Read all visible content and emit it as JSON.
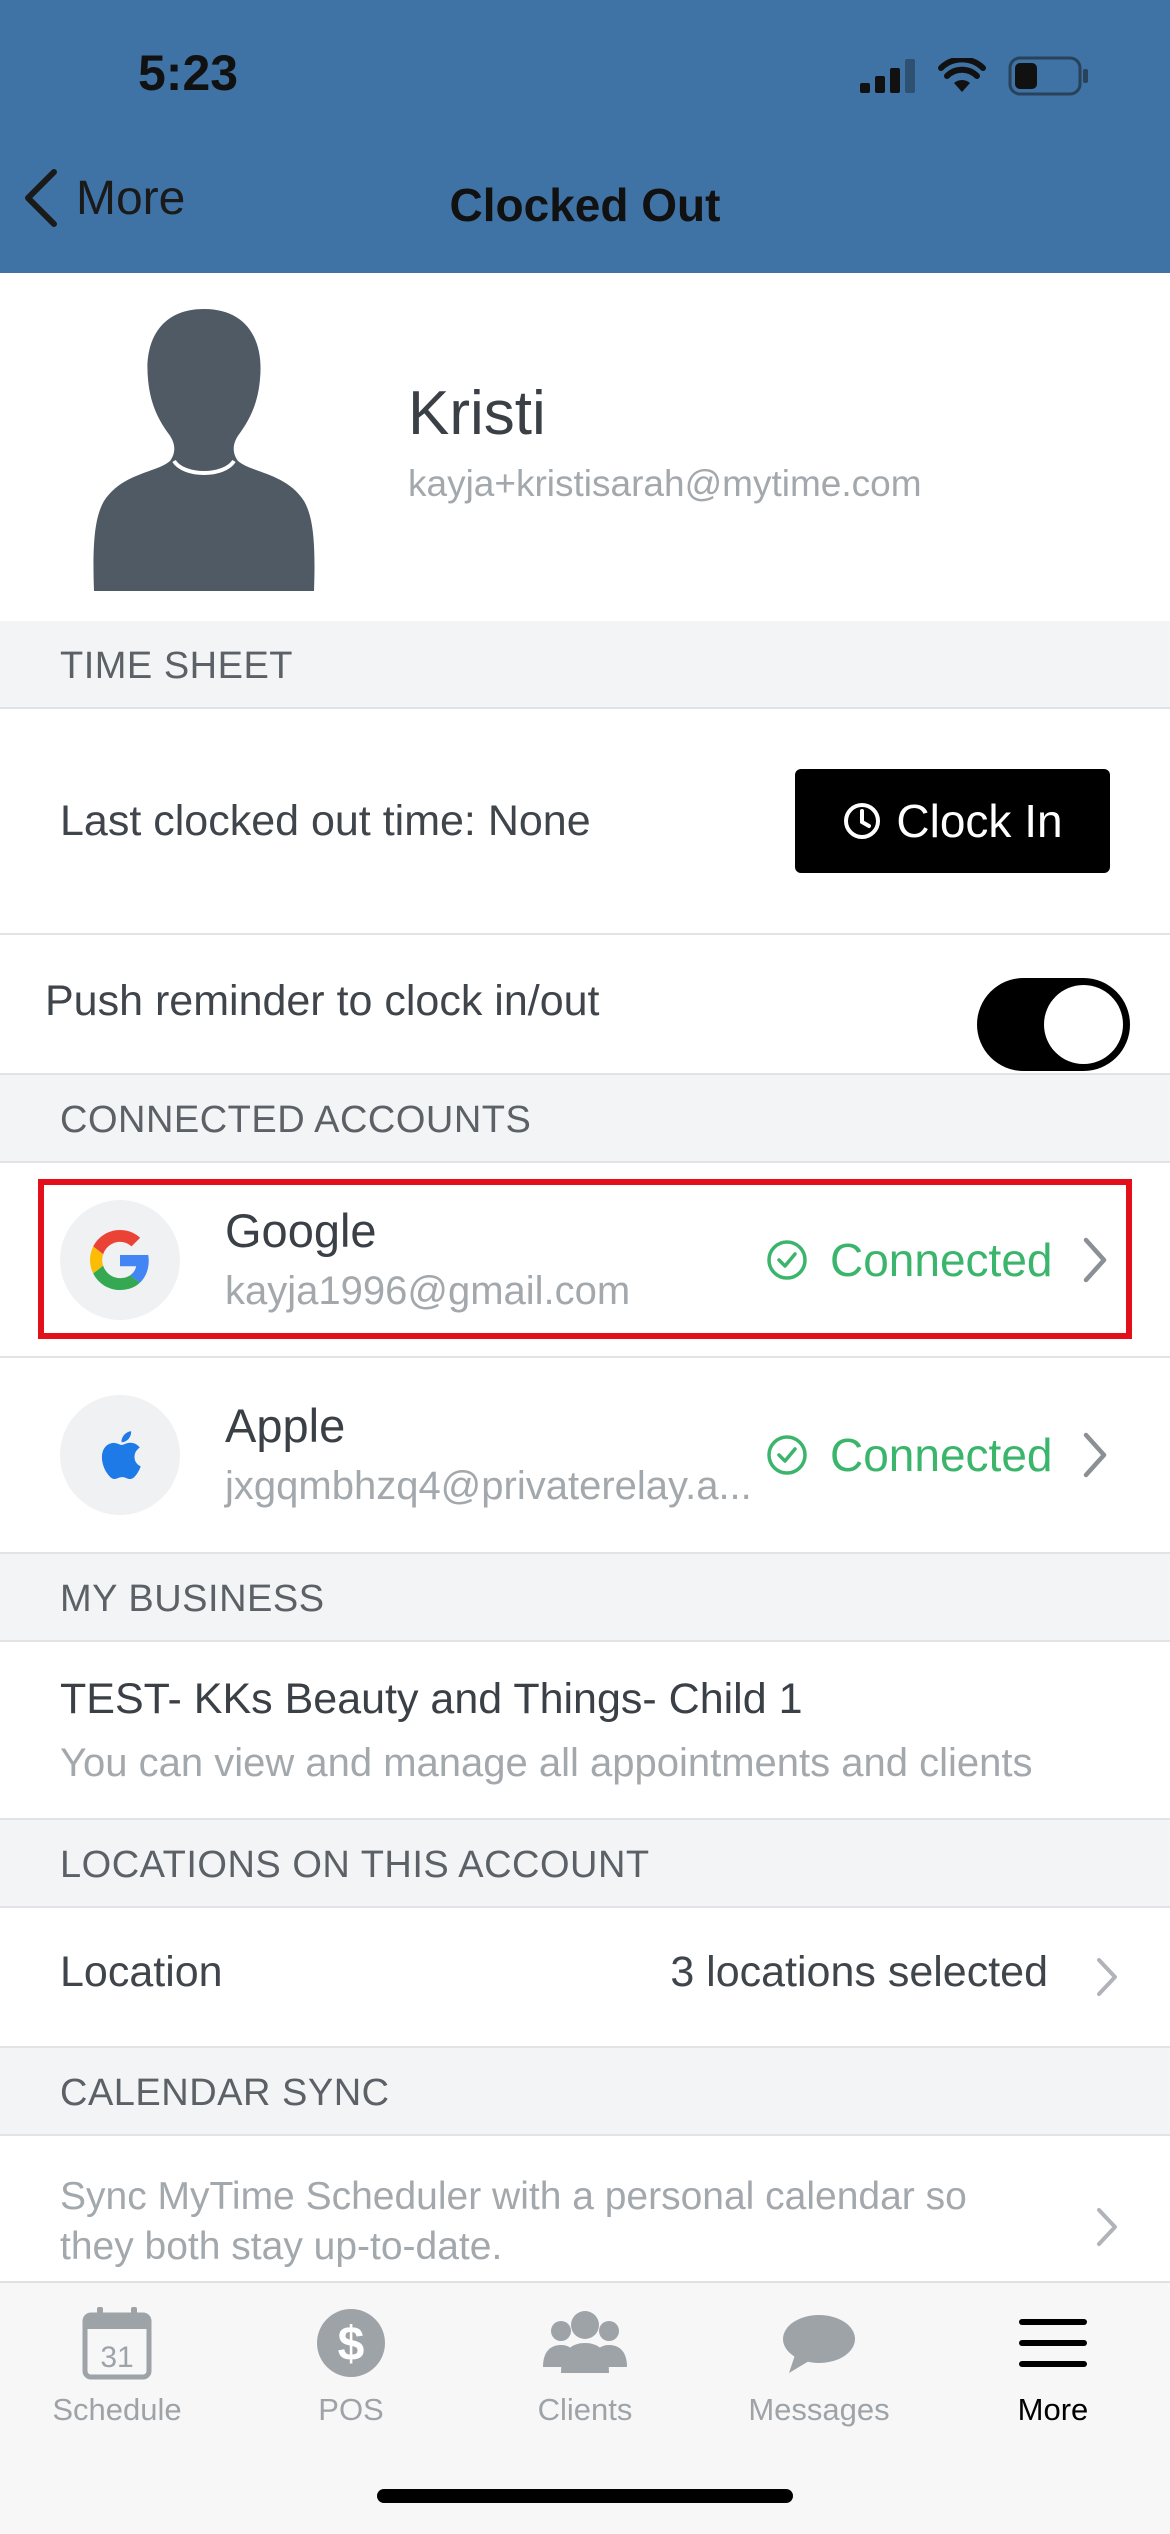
{
  "status_bar": {
    "time": "5:23"
  },
  "nav": {
    "back_label": "More",
    "title": "Clocked Out"
  },
  "profile": {
    "name": "Kristi",
    "email": "kayja+kristisarah@mytime.com"
  },
  "time_sheet": {
    "header": "TIME SHEET",
    "last_clocked_out": "Last clocked out time: None",
    "clock_in_label": "Clock In",
    "push_reminder_label": "Push reminder to clock in/out",
    "push_reminder_on": true
  },
  "connected_accounts": {
    "header": "CONNECTED ACCOUNTS",
    "items": [
      {
        "provider": "Google",
        "email": "kayja1996@gmail.com",
        "status": "Connected",
        "icon": "google-icon"
      },
      {
        "provider": "Apple",
        "email": "jxgqmbhzq4@privaterelay.a...",
        "status": "Connected",
        "icon": "apple-icon"
      }
    ]
  },
  "my_business": {
    "header": "MY BUSINESS",
    "name": "TEST- KKs Beauty and Things- Child 1",
    "description": "You can view and manage all appointments and clients"
  },
  "locations": {
    "header": "LOCATIONS ON THIS ACCOUNT",
    "label": "Location",
    "value": "3 locations selected"
  },
  "calendar_sync": {
    "header": "CALENDAR SYNC",
    "text": "Sync MyTime Scheduler with a personal calendar so they both stay up-to-date."
  },
  "tab_bar": {
    "items": [
      {
        "label": "Schedule",
        "icon": "calendar-icon",
        "badge": "31"
      },
      {
        "label": "POS",
        "icon": "dollar-icon",
        "badge": "$"
      },
      {
        "label": "Clients",
        "icon": "people-icon"
      },
      {
        "label": "Messages",
        "icon": "chat-bubble-icon"
      },
      {
        "label": "More",
        "icon": "menu-icon",
        "active": true
      }
    ]
  },
  "colors": {
    "header_bg": "#3f73a5",
    "connected_green": "#3bb56b",
    "highlight_red": "#e3101b"
  }
}
